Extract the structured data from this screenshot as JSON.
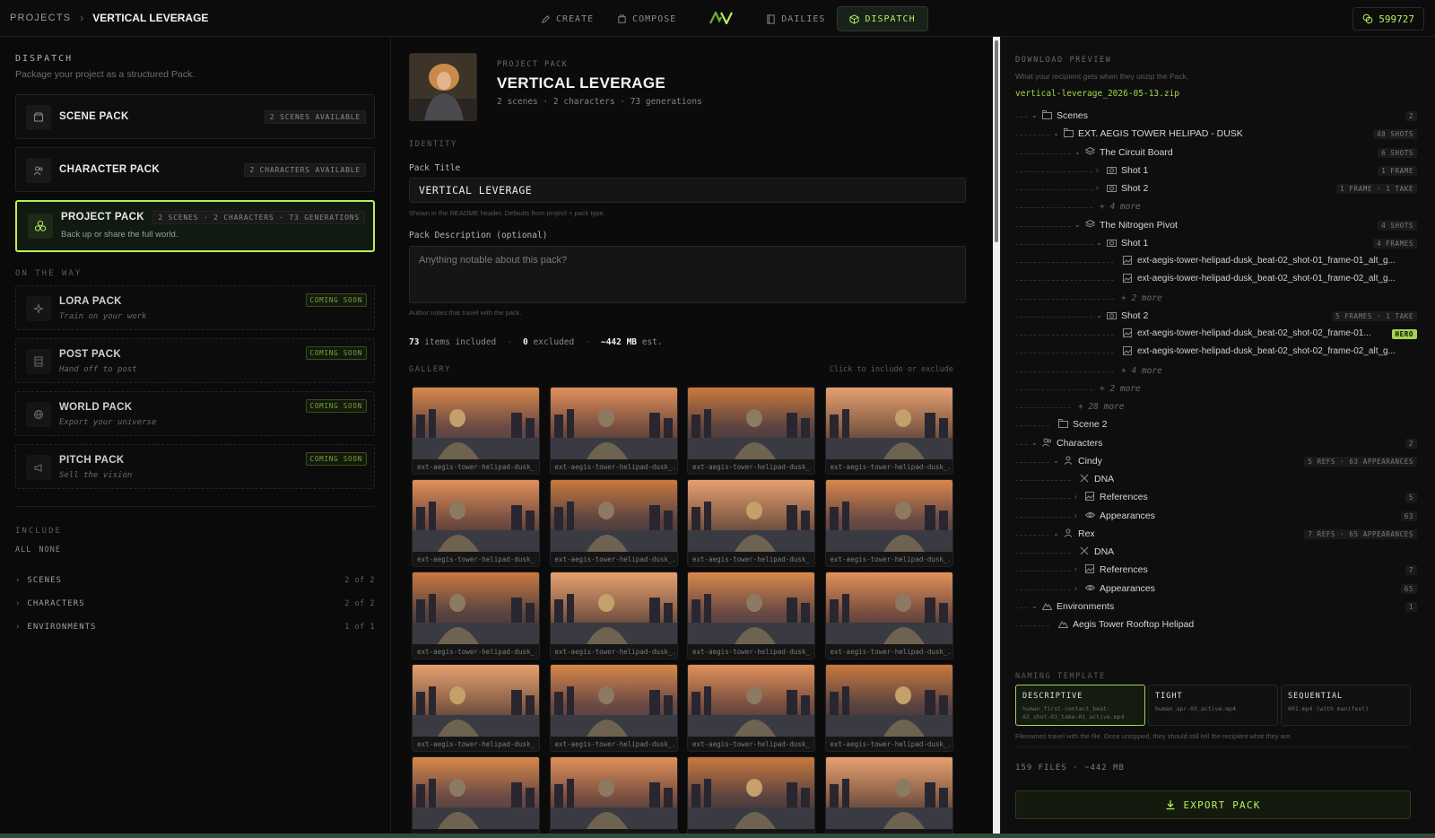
{
  "header": {
    "breadcrumb_root": "PROJECTS",
    "breadcrumb_current": "VERTICAL LEVERAGE",
    "nav": [
      {
        "label": "CREATE",
        "icon": "pen-icon"
      },
      {
        "label": "COMPOSE",
        "icon": "compose-icon"
      },
      {
        "label": "DAILIES",
        "icon": "film-icon"
      },
      {
        "label": "DISPATCH",
        "icon": "package-icon",
        "active": true
      }
    ],
    "credits": "599727"
  },
  "left": {
    "title": "DISPATCH",
    "subtitle": "Package your project as a structured Pack.",
    "packs": [
      {
        "name": "SCENE PACK",
        "badge": "2 SCENES AVAILABLE",
        "icon": "scene-icon"
      },
      {
        "name": "CHARACTER PACK",
        "badge": "2 CHARACTERS AVAILABLE",
        "icon": "users-icon"
      },
      {
        "name": "PROJECT PACK",
        "badge": "2 SCENES · 2 CHARACTERS · 73 GENERATIONS",
        "desc": "Back up or share the full world.",
        "icon": "project-icon",
        "active": true
      }
    ],
    "on_the_way_label": "ON THE WAY",
    "coming": [
      {
        "name": "LORA PACK",
        "desc": "Train on your work",
        "badge": "COMING SOON"
      },
      {
        "name": "POST PACK",
        "desc": "Hand off to post",
        "badge": "COMING SOON"
      },
      {
        "name": "WORLD PACK",
        "desc": "Export your universe",
        "badge": "COMING SOON"
      },
      {
        "name": "PITCH PACK",
        "desc": "Sell the vision",
        "badge": "COMING SOON"
      }
    ],
    "include_label": "INCLUDE",
    "include_all": "ALL",
    "include_none": "NONE",
    "include_rows": [
      {
        "label": "SCENES",
        "count": "2 of 2"
      },
      {
        "label": "CHARACTERS",
        "count": "2 of 2"
      },
      {
        "label": "ENVIRONMENTS",
        "count": "1 of 1"
      }
    ]
  },
  "center": {
    "kicker": "PROJECT PACK",
    "title": "VERTICAL LEVERAGE",
    "meta": "2 scenes · 2 characters · 73 generations",
    "identity_label": "IDENTITY",
    "pack_title_label": "Pack Title",
    "pack_title_value": "VERTICAL LEVERAGE",
    "pack_title_hint": "Shown in the README header. Defaults from project + pack type.",
    "desc_label": "Pack Description (optional)",
    "desc_placeholder": "Anything notable about this pack?",
    "desc_hint": "Author notes that travel with the pack.",
    "stats": {
      "included": "73",
      "included_label": "items included",
      "excluded": "0",
      "excluded_label": "excluded",
      "size": "~442 MB",
      "size_label": "est."
    },
    "gallery_label": "GALLERY",
    "gallery_hint": "Click to include or exclude",
    "gallery_caption": "ext-aegis-tower-helipad-dusk_..."
  },
  "right": {
    "title": "DOWNLOAD PREVIEW",
    "subtitle": "What your recipient gets when they unzip the Pack.",
    "filename": "vertical-leverage_2026-05-13.zip",
    "tree": [
      {
        "label": "Scenes",
        "badge": "2"
      },
      {
        "label": "EXT. AEGIS TOWER HELIPAD - DUSK",
        "badge": "40 SHOTS"
      },
      {
        "label": "The Circuit Board",
        "badge": "6 SHOTS"
      },
      {
        "label": "Shot 1",
        "badge": "1 FRAME"
      },
      {
        "label": "Shot 2",
        "badge": "1 FRAME · 1 TAKE"
      },
      {
        "label": "+ 4 more"
      },
      {
        "label": "The Nitrogen Pivot",
        "badge": "4 SHOTS"
      },
      {
        "label": "Shot 1",
        "badge": "4 FRAMES"
      },
      {
        "label": "ext-aegis-tower-helipad-dusk_beat-02_shot-01_frame-01_alt_g..."
      },
      {
        "label": "ext-aegis-tower-helipad-dusk_beat-02_shot-01_frame-02_alt_g..."
      },
      {
        "label": "+ 2 more"
      },
      {
        "label": "Shot 2",
        "badge": "5 FRAMES · 1 TAKE"
      },
      {
        "label": "ext-aegis-tower-helipad-dusk_beat-02_shot-02_frame-01...",
        "badge": "HERO"
      },
      {
        "label": "ext-aegis-tower-helipad-dusk_beat-02_shot-02_frame-02_alt_g..."
      },
      {
        "label": "+ 4 more"
      },
      {
        "label": "+ 2 more"
      },
      {
        "label": "+ 28 more"
      },
      {
        "label": "Scene 2"
      },
      {
        "label": "Characters",
        "badge": "2"
      },
      {
        "label": "Cindy",
        "badge": "5 REFS · 63 APPEARANCES"
      },
      {
        "label": "DNA"
      },
      {
        "label": "References",
        "badge": "5"
      },
      {
        "label": "Appearances",
        "badge": "63"
      },
      {
        "label": "Rex",
        "badge": "7 REFS · 65 APPEARANCES"
      },
      {
        "label": "DNA"
      },
      {
        "label": "References",
        "badge": "7"
      },
      {
        "label": "Appearances",
        "badge": "65"
      },
      {
        "label": "Environments",
        "badge": "1"
      },
      {
        "label": "Aegis Tower Rooftop Helipad"
      }
    ],
    "naming_label": "NAMING TEMPLATE",
    "naming": [
      {
        "name": "DESCRIPTIVE",
        "example": "human_first-contact_beat-02_shot-03_take-01_active.mp4",
        "active": true
      },
      {
        "name": "TIGHT",
        "example": "human_apr-03_active.mp4"
      },
      {
        "name": "SEQUENTIAL",
        "example": "001.mp4 (with manifest)"
      }
    ],
    "naming_hint": "Filenames travel with the file. Once unzipped, they should still tell the recipient what they are.",
    "summary": "159 FILES · ~442 MB",
    "export_label": "EXPORT PACK"
  },
  "colors": {
    "accent": "#b8f05c",
    "bg": "#0b0b0b",
    "panel": "#0e0e0e",
    "hero": "#a4d44f"
  }
}
